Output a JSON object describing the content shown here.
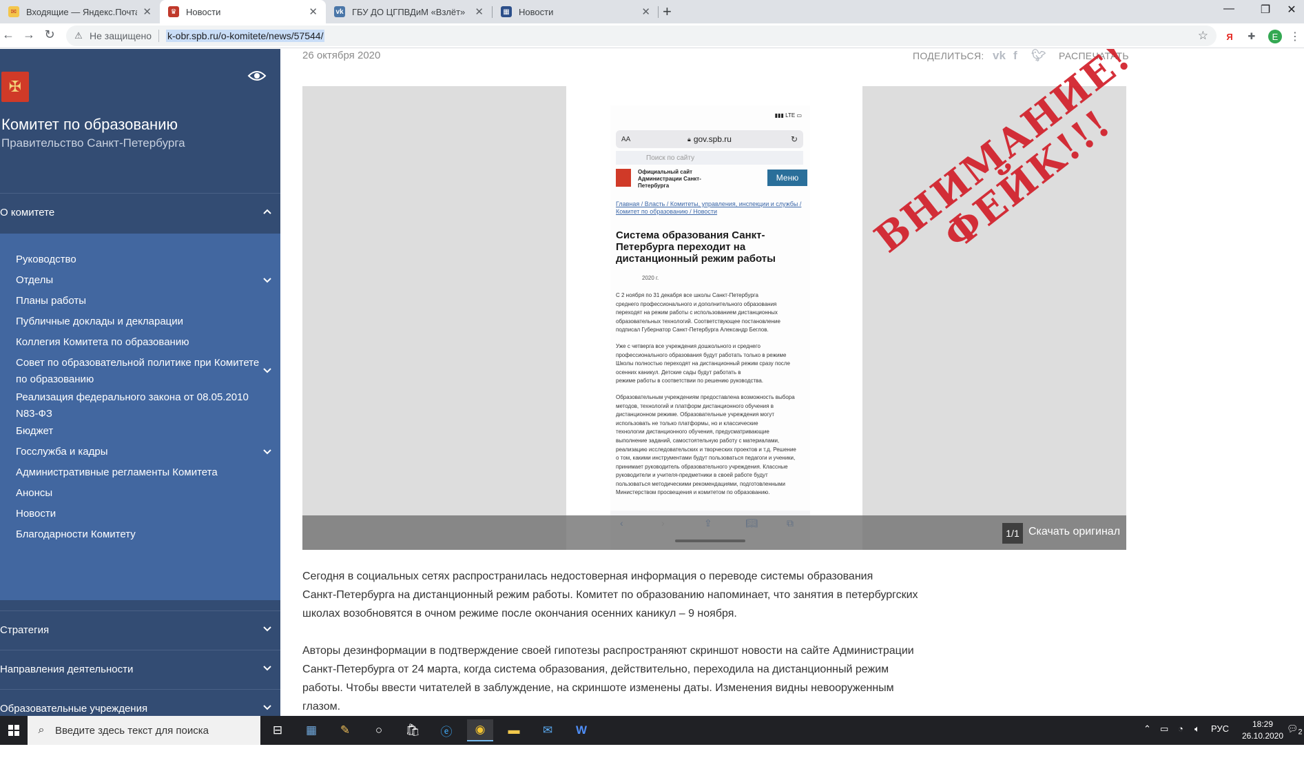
{
  "browser": {
    "tabs": [
      {
        "title": "Входящие — Яндекс.Почта",
        "active": false,
        "favicon": "yandex-mail-icon"
      },
      {
        "title": "Новости",
        "active": true,
        "favicon": "spb-coat-icon"
      },
      {
        "title": "ГБУ ДО ЦГПВДиМ «Взлёт»",
        "active": false,
        "favicon": "vk-icon"
      },
      {
        "title": "Новости",
        "active": false,
        "favicon": "site-icon"
      }
    ],
    "not_secure": "Не защищено",
    "url": "k-obr.spb.ru/o-komitete/news/57544/",
    "profile_initial": "E"
  },
  "sidebar": {
    "org_name": "Комитет по образованию",
    "org_gov": "Правительство Санкт-Петербурга",
    "sections": [
      {
        "label": "О комитете",
        "expanded": true
      },
      {
        "label": "Стратегия",
        "expanded": false
      },
      {
        "label": "Направления деятельности",
        "expanded": false
      },
      {
        "label": "Образовательные учреждения",
        "expanded": false
      }
    ],
    "submenu": [
      {
        "label": "Руководство",
        "has_children": false
      },
      {
        "label": "Отделы",
        "has_children": true
      },
      {
        "label": "Планы работы",
        "has_children": false
      },
      {
        "label": "Публичные доклады и декларации",
        "has_children": false
      },
      {
        "label": "Коллегия Комитета по образованию",
        "has_children": false
      },
      {
        "label": "Совет по образовательной политике при Комитете по образованию",
        "has_children": true
      },
      {
        "label": "Реализация федерального закона от 08.05.2010 N83-ФЗ",
        "has_children": false
      },
      {
        "label": "Бюджет",
        "has_children": false
      },
      {
        "label": "Госслужба и кадры",
        "has_children": true
      },
      {
        "label": "Административные регламенты Комитета",
        "has_children": false
      },
      {
        "label": "Анонсы",
        "has_children": false
      },
      {
        "label": "Новости",
        "has_children": false
      },
      {
        "label": "Благодарности Комитету",
        "has_children": false
      }
    ]
  },
  "article": {
    "date": "26 октября 2020",
    "share_label": "ПОДЕЛИТЬСЯ:",
    "print_label": "РАСПЕЧАТАТЬ",
    "gallery": {
      "counter": "1/1",
      "download_label": "Скачать оригинал",
      "stamp_line1": "ВНИМАНИЕ!",
      "stamp_line2": "ФЕЙК!!!",
      "phone": {
        "status": "LTE",
        "aa": "AA",
        "url": "gov.spb.ru",
        "search_placeholder": "Поиск по сайту",
        "site_title": "Официальный сайт Администрации Санкт-Петербурга",
        "menu": "Меню",
        "breadcrumbs": "Главная / Власть / Комитеты, управления, инспекции и службы / Комитет по образованию / Новости",
        "headline": "Система образования Санкт-Петербурга переходит на дистанционный режим работы",
        "year": "2020 г.",
        "body": [
          "С 2 ноября по 31 декабря все школы Санкт-Петербурга",
          "среднего профессионального и дополнительного образования",
          "переходят на режим работы с использованием дистанционных",
          "образовательных технологий. Соответствующее постановление",
          "подписал Губернатор Санкт-Петербурга Александр Беглов.",
          "",
          "Уже с четверга все учреждения дошкольного и среднего",
          "профессионального образования будут работать только в режиме",
          "Школы полностью переходят на дистанционный режим сразу после",
          "осенних каникул. Детские сады будут работать в",
          "режиме работы в соответствии по решению руководства.",
          "",
          "Образовательным учреждениям предоставлена возможность выбора",
          "методов, технологий и платформ дистанционного обучения в",
          "дистанционном режиме. Образовательные учреждения могут",
          "использовать не только платформы, но и классические",
          "технологии дистанционного обучения, предусматривающие",
          "выполнение заданий, самостоятельную работу с материалами,",
          "реализацию исследовательских и творческих проектов и т.д. Решение",
          "о том, какими инструментами будут пользоваться педагоги и ученики,",
          "принимает руководитель образовательного учреждения. Классные",
          "руководители и учителя-предметники в своей работе будут",
          "пользоваться методическими рекомендациями, подготовленными",
          "Министерством просвещения и комитетом по образованию."
        ]
      }
    },
    "paragraphs": [
      [
        "Сегодня в социальных сетях распространилась недостоверная информация о переводе системы образования",
        "Санкт-Петербурга на дистанционный режим работы. Комитет по образованию напоминает, что занятия в петербургских",
        "школах возобновятся в очном режиме после окончания осенних каникул – 9 ноября."
      ],
      [
        "Авторы дезинформации в подтверждение своей гипотезы распространяют скриншот новости на сайте Администрации",
        "Санкт-Петербурга от 24 марта, когда система образования, действительно, переходила на дистанционный режим",
        "работы. Чтобы ввести читателей в заблуждение, на скриншоте изменены даты. Изменения видны невооруженным",
        "глазом."
      ]
    ]
  },
  "taskbar": {
    "search_placeholder": "Введите здесь текст для поиска",
    "language": "РУС",
    "time": "18:29",
    "date": "26.10.2020",
    "notifications": "2"
  }
}
